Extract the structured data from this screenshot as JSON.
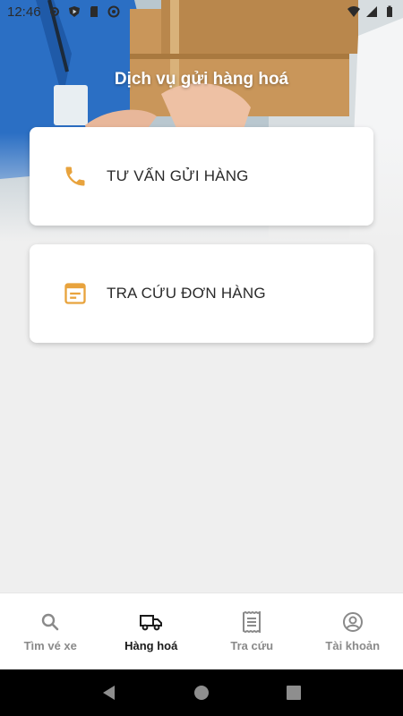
{
  "status_bar": {
    "time": "12:46",
    "left_icons": [
      "settings-icon",
      "play-protect-icon",
      "sd-card-icon",
      "do-not-disturb-icon"
    ],
    "right_icons": [
      "wifi-icon",
      "signal-icon",
      "battery-icon"
    ]
  },
  "header": {
    "title": "Dịch vụ gửi hàng hoá"
  },
  "cards": [
    {
      "label": "TƯ VẤN GỬI HÀNG",
      "icon": "phone-icon"
    },
    {
      "label": "TRA CỨU ĐƠN HÀNG",
      "icon": "document-icon"
    }
  ],
  "bottom_nav": {
    "items": [
      {
        "label": "Tìm vé xe",
        "icon": "search-icon",
        "active": false
      },
      {
        "label": "Hàng hoá",
        "icon": "truck-icon",
        "active": true
      },
      {
        "label": "Tra cứu",
        "icon": "receipt-icon",
        "active": false
      },
      {
        "label": "Tài khoản",
        "icon": "account-icon",
        "active": false
      }
    ]
  },
  "colors": {
    "accent": "#e8a33d",
    "active_nav": "#1a1a1a",
    "inactive_nav": "#8a8a8a"
  }
}
